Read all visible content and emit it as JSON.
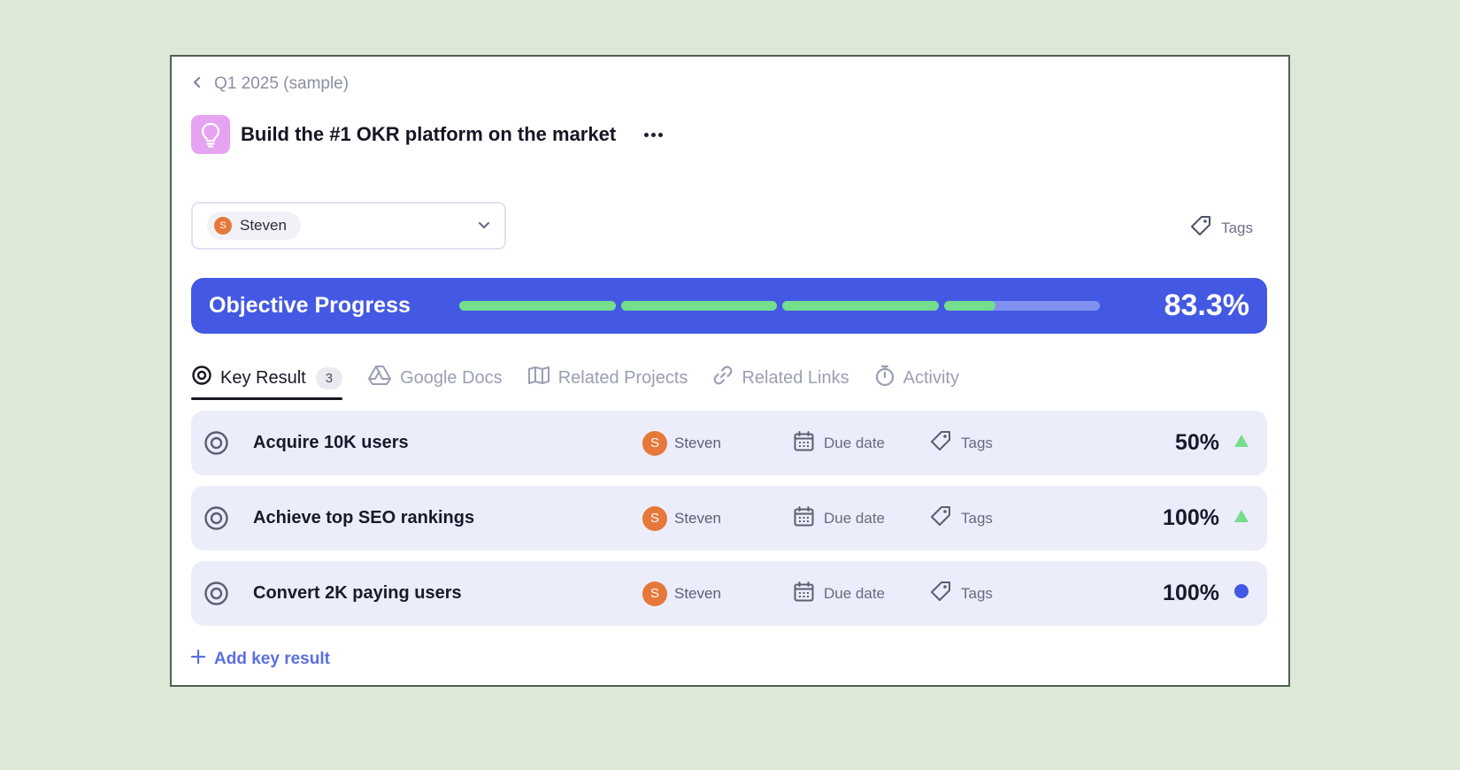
{
  "breadcrumb": {
    "label": "Q1 2025 (sample)"
  },
  "objective": {
    "title": "Build the #1 OKR platform on the market"
  },
  "owner_select": {
    "name": "Steven",
    "initial": "S"
  },
  "tags_label": "Tags",
  "progress": {
    "label": "Objective Progress",
    "value_text": "83.3%",
    "fraction": 0.833,
    "colors": {
      "banner": "#4359e3",
      "fill": "#74de8c",
      "track": "#8191ef"
    }
  },
  "tabs": [
    {
      "label": "Key Result",
      "count": "3",
      "icon": "target-icon",
      "active": true
    },
    {
      "label": "Google Docs",
      "icon": "google-drive-icon",
      "active": false
    },
    {
      "label": "Related Projects",
      "icon": "map-icon",
      "active": false
    },
    {
      "label": "Related Links",
      "icon": "link-icon",
      "active": false
    },
    {
      "label": "Activity",
      "icon": "stopwatch-icon",
      "active": false
    }
  ],
  "key_results": [
    {
      "title": "Acquire 10K users",
      "owner": "Steven",
      "owner_initial": "S",
      "due": "Due date",
      "tags": "Tags",
      "percent": "50%",
      "status_icon": "triangle-up-icon",
      "status_color": "#74de8c"
    },
    {
      "title": "Achieve top SEO rankings",
      "owner": "Steven",
      "owner_initial": "S",
      "due": "Due date",
      "tags": "Tags",
      "percent": "100%",
      "status_icon": "triangle-up-icon",
      "status_color": "#74de8c"
    },
    {
      "title": "Convert 2K paying users",
      "owner": "Steven",
      "owner_initial": "S",
      "due": "Due date",
      "tags": "Tags",
      "percent": "100%",
      "status_icon": "dot-icon",
      "status_color": "#4359e3"
    }
  ],
  "add_key_result_label": "Add key result",
  "colors": {
    "background": "#dde8d6",
    "avatar": "#e6783a",
    "objective_icon_bg": "#e6a3f1",
    "row_bg": "#ecedfa"
  }
}
